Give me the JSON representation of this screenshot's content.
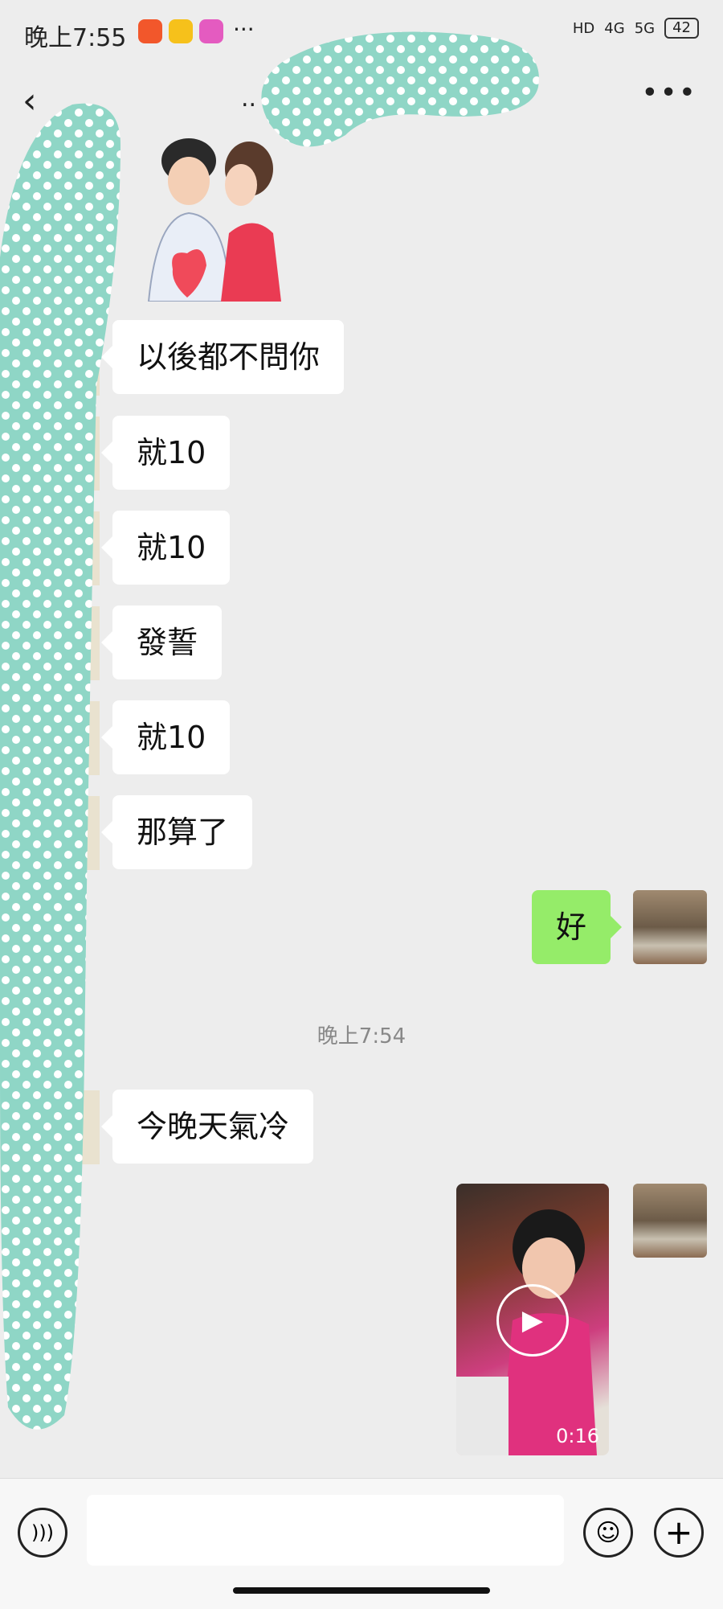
{
  "status_bar": {
    "time": "晚上7:55",
    "net_a": "HD",
    "net_b": "4G",
    "net_c": "5G",
    "battery": "42"
  },
  "header": {
    "title": "..",
    "back_icon": "chevron-left-icon",
    "more_icon": "more-icon"
  },
  "messages": [
    {
      "side": "left",
      "text": "以後都不問你"
    },
    {
      "side": "left",
      "text": "就10"
    },
    {
      "side": "left",
      "text": "就10"
    },
    {
      "side": "left",
      "text": "發誓"
    },
    {
      "side": "left",
      "text": "就10"
    },
    {
      "side": "left",
      "text": "那算了"
    },
    {
      "side": "right",
      "text": "好"
    },
    {
      "side": "left",
      "text": "今晚天氣冷"
    }
  ],
  "timestamp": "晚上7:54",
  "video": {
    "duration": "0:16",
    "play_icon": "play-icon"
  },
  "input": {
    "voice_icon": "voice-icon",
    "emoji_icon": "emoji-icon",
    "add_icon": "plus-icon"
  }
}
